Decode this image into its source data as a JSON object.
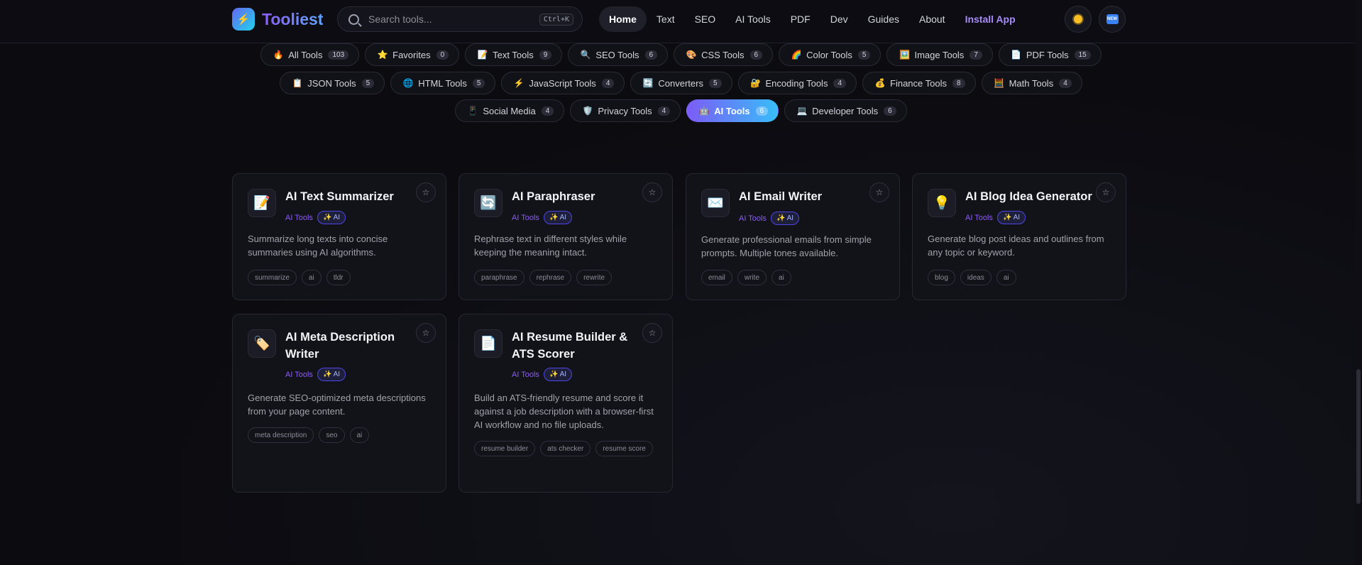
{
  "app": {
    "name": "Tooliest",
    "logo_emoji": "⚡"
  },
  "search": {
    "placeholder": "Search tools...",
    "shortcut": "Ctrl+K"
  },
  "nav": {
    "items": [
      {
        "label": "Home",
        "active": true
      },
      {
        "label": "Text"
      },
      {
        "label": "SEO"
      },
      {
        "label": "AI Tools"
      },
      {
        "label": "PDF"
      },
      {
        "label": "Dev"
      },
      {
        "label": "Guides"
      },
      {
        "label": "About"
      }
    ],
    "install_label": "Install App",
    "theme_icon": "sun-icon",
    "new_icon": "new-badge-icon",
    "new_text": "NEW"
  },
  "categories": {
    "rows": [
      [
        {
          "emoji": "🔥",
          "label": "All Tools",
          "count": "103"
        },
        {
          "emoji": "⭐",
          "label": "Favorites",
          "count": "0"
        },
        {
          "emoji": "📝",
          "label": "Text Tools",
          "count": "9"
        },
        {
          "emoji": "🔍",
          "label": "SEO Tools",
          "count": "6"
        },
        {
          "emoji": "🎨",
          "label": "CSS Tools",
          "count": "6"
        },
        {
          "emoji": "🌈",
          "label": "Color Tools",
          "count": "5"
        },
        {
          "emoji": "🖼️",
          "label": "Image Tools",
          "count": "7"
        },
        {
          "emoji": "📄",
          "label": "PDF Tools",
          "count": "15"
        }
      ],
      [
        {
          "emoji": "📋",
          "label": "JSON Tools",
          "count": "5"
        },
        {
          "emoji": "🌐",
          "label": "HTML Tools",
          "count": "5"
        },
        {
          "emoji": "⚡",
          "label": "JavaScript Tools",
          "count": "4"
        },
        {
          "emoji": "🔄",
          "label": "Converters",
          "count": "5"
        },
        {
          "emoji": "🔐",
          "label": "Encoding Tools",
          "count": "4"
        },
        {
          "emoji": "💰",
          "label": "Finance Tools",
          "count": "8"
        },
        {
          "emoji": "🧮",
          "label": "Math Tools",
          "count": "4"
        }
      ],
      [
        {
          "emoji": "📱",
          "label": "Social Media",
          "count": "4"
        },
        {
          "emoji": "🛡️",
          "label": "Privacy Tools",
          "count": "4"
        },
        {
          "emoji": "🤖",
          "label": "AI Tools",
          "count": "6",
          "active": true
        },
        {
          "emoji": "💻",
          "label": "Developer Tools",
          "count": "6"
        }
      ]
    ]
  },
  "tools": [
    {
      "icon_emoji": "📝",
      "title": "AI Text Summarizer",
      "category": "AI Tools",
      "badge": "✨ AI",
      "description": "Summarize long texts into concise summaries using AI algorithms.",
      "tags": [
        "summarize",
        "ai",
        "tldr"
      ]
    },
    {
      "icon_emoji": "🔄",
      "title": "AI Paraphraser",
      "category": "AI Tools",
      "badge": "✨ AI",
      "description": "Rephrase text in different styles while keeping the meaning intact.",
      "tags": [
        "paraphrase",
        "rephrase",
        "rewrite"
      ]
    },
    {
      "icon_emoji": "✉️",
      "title": "AI Email Writer",
      "category": "AI Tools",
      "badge": "✨ AI",
      "description": "Generate professional emails from simple prompts. Multiple tones available.",
      "tags": [
        "email",
        "write",
        "ai"
      ]
    },
    {
      "icon_emoji": "💡",
      "title": "AI Blog Idea Generator",
      "category": "AI Tools",
      "badge": "✨ AI",
      "description": "Generate blog post ideas and outlines from any topic or keyword.",
      "tags": [
        "blog",
        "ideas",
        "ai"
      ]
    },
    {
      "icon_emoji": "🏷️",
      "title": "AI Meta Description Writer",
      "category": "AI Tools",
      "badge": "✨ AI",
      "description": "Generate SEO-optimized meta descriptions from your page content.",
      "tags": [
        "meta description",
        "seo",
        "ai"
      ]
    },
    {
      "icon_emoji": "📄",
      "title": "AI Resume Builder & ATS Scorer",
      "category": "AI Tools",
      "badge": "✨ AI",
      "description": "Build an ATS-friendly resume and score it against a job description with a browser-first AI workflow and no file uploads.",
      "tags": [
        "resume builder",
        "ats checker",
        "resume score"
      ]
    }
  ],
  "favorite_icon": "☆"
}
